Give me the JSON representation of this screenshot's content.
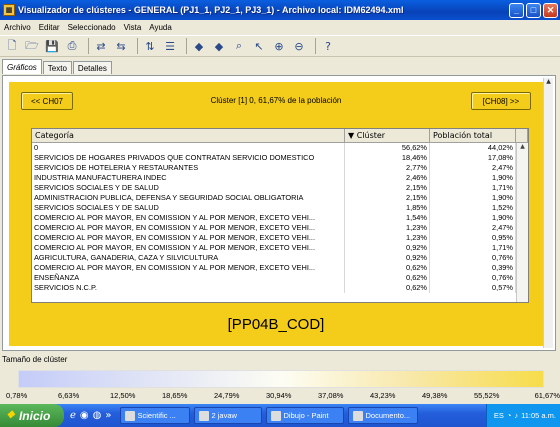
{
  "window": {
    "title": "Visualizador de clústeres - GENERAL (PJ1_1, PJ2_1, PJ3_1) - Archivo local: IDM62494.xml",
    "app_icon": "cluster-app-icon"
  },
  "menu": [
    "Archivo",
    "Editar",
    "Seleccionado",
    "Vista",
    "Ayuda"
  ],
  "toolbar": [
    "new-icon",
    "open-icon",
    "save-icon",
    "print-icon",
    "redo-icon",
    "undo-icon",
    "sort-icon",
    "filter-icon",
    "back-icon",
    "forward-icon",
    "find-icon",
    "select-icon",
    "zoom-in-icon",
    "zoom-out-icon",
    "help-icon"
  ],
  "tabs": [
    {
      "label": "Gráficos",
      "active": true
    },
    {
      "label": "Texto",
      "active": false
    },
    {
      "label": "Detalles",
      "active": false
    }
  ],
  "panel": {
    "prev_label": "<< CH07",
    "next_label": "[CH08] >>",
    "cluster_title": "Clúster [1] 0, 61,67% de la población",
    "variable": "[PP04B_COD]"
  },
  "table": {
    "headers": [
      "Categoría",
      "▼ Clúster",
      "Población total"
    ],
    "rows": [
      [
        "0",
        "56,62%",
        "44,02%"
      ],
      [
        "SERVICIOS DE HOGARES PRIVADOS QUE CONTRATAN SERVICIO DOMESTICO",
        "18,46%",
        "17,08%"
      ],
      [
        "SERVICIOS DE HOTELERIA Y RESTAURANTES",
        "2,77%",
        "2,47%"
      ],
      [
        "INDUSTRIA MANUFACTURERA INDEC",
        "2,46%",
        "1,90%"
      ],
      [
        "SERVICIOS SOCIALES Y DE SALUD",
        "2,15%",
        "1,71%"
      ],
      [
        "ADMINISTRACION PUBLICA, DEFENSA Y SEGURIDAD SOCIAL OBLIGATORIA",
        "2,15%",
        "1,90%"
      ],
      [
        "SERVICIOS SOCIALES Y DE SALUD",
        "1,85%",
        "1,52%"
      ],
      [
        "COMERCIO AL POR MAYOR, EN COMISSION Y AL POR MENOR, EXCETO VEHI...",
        "1,54%",
        "1,90%"
      ],
      [
        "COMERCIO AL POR MAYOR, EN COMISSION Y AL POR MENOR, EXCETO VEHI...",
        "1,23%",
        "2,47%"
      ],
      [
        "COMERCIO AL POR MAYOR, EN COMISSION Y AL POR MENOR, EXCETO VEHI...",
        "1,23%",
        "0,95%"
      ],
      [
        "COMERCIO AL POR MAYOR, EN COMISSION Y AL POR MENOR, EXCETO VEHI...",
        "0,92%",
        "1,71%"
      ],
      [
        "AGRICULTURA, GANADERIA, CAZA Y SILVICULTURA",
        "0,92%",
        "0,76%"
      ],
      [
        "COMERCIO AL POR MAYOR, EN COMISSION Y AL POR MENOR, EXCETO VEHI...",
        "0,62%",
        "0,39%"
      ],
      [
        "ENSEÑANZA",
        "0,62%",
        "0,76%"
      ],
      [
        "SERVICIOS N.C.P.",
        "0,62%",
        "0,57%"
      ]
    ]
  },
  "size": {
    "label": "Tamaño de clúster",
    "ticks": [
      "0,78%",
      "6,63%",
      "12,50%",
      "18,65%",
      "24,79%",
      "30,94%",
      "37,08%",
      "43,23%",
      "49,38%",
      "55,52%",
      "61,67%"
    ]
  },
  "taskbar": {
    "start": "Inicio",
    "tasks": [
      "Scientific ...",
      "2 javaw",
      "Dibujo - Paint",
      "Documento...",
      "ES"
    ],
    "clock": "11:05 a.m."
  },
  "colors": {
    "panel_yellow": "#f4cc1a",
    "titlebar_blue": "#0a5fe0"
  }
}
